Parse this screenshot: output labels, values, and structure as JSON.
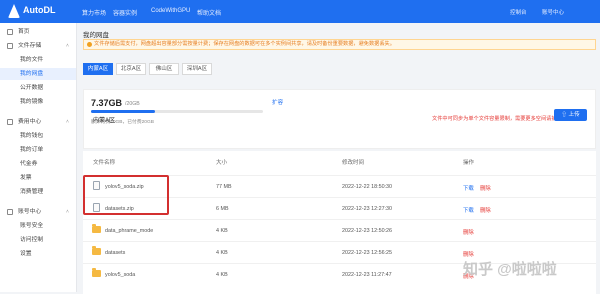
{
  "app": {
    "brand": "AutoDL"
  },
  "topnav": {
    "items": [
      "算力市场",
      "容器实例",
      "CodeWithGPU",
      "帮助文档"
    ],
    "user_menu": [
      "控制台",
      "账号中心"
    ]
  },
  "sidebar": {
    "items": [
      {
        "label": "首页",
        "type": "top"
      },
      {
        "label": "文件存储",
        "type": "group"
      },
      {
        "label": "我的文件",
        "type": "sub"
      },
      {
        "label": "我的网盘",
        "type": "sub",
        "active": true
      },
      {
        "label": "公开数据",
        "type": "sub"
      },
      {
        "label": "我的镜像",
        "type": "sub"
      },
      {
        "label": "费用中心",
        "type": "group"
      },
      {
        "label": "我的钱包",
        "type": "sub"
      },
      {
        "label": "我的订单",
        "type": "sub"
      },
      {
        "label": "代金券",
        "type": "sub"
      },
      {
        "label": "发票",
        "type": "sub"
      },
      {
        "label": "消费管理",
        "type": "sub"
      },
      {
        "label": "账号中心",
        "type": "group"
      },
      {
        "label": "账号安全",
        "type": "sub"
      },
      {
        "label": "访问控制",
        "type": "sub"
      },
      {
        "label": "设置",
        "type": "sub"
      }
    ]
  },
  "page": {
    "title": "我的网盘",
    "notice": "文件存储后需支付，网盘超出容量部分需按量计费；保存在网盘的数据可在多个实例间共享，请及时备份重要数据，避免数据丢失。"
  },
  "tabs": [
    {
      "label": "内蒙A区",
      "active": true
    },
    {
      "label": "北京A区"
    },
    {
      "label": "佛山区"
    },
    {
      "label": "深圳A区"
    }
  ],
  "storage": {
    "used": "7.37GB",
    "total": "/20GB",
    "usage_fraction": 0.37,
    "expand": "扩容",
    "extra": "额外付费20GB，已付费20GB"
  },
  "region": {
    "title": "内蒙A区",
    "note": "文件中可同步为单个文件容量限制，需要更多空间请扩容",
    "upload": "上传"
  },
  "table": {
    "headers": [
      "文件名称",
      "大小",
      "修改时间",
      "操作"
    ],
    "rows": [
      {
        "name": "yolov5_soda.zip",
        "size": "77 MB",
        "time": "2022-12-22 18:50:30",
        "actions": [
          "下载",
          "删除"
        ],
        "kind": "file"
      },
      {
        "name": "datasets.zip",
        "size": "6 MB",
        "time": "2022-12-23 12:27:30",
        "actions": [
          "下载",
          "删除"
        ],
        "kind": "file"
      },
      {
        "name": "data_phrame_mode",
        "size": "4 KB",
        "time": "2022-12-23 12:50:26",
        "actions": [
          "删除"
        ],
        "kind": "folder"
      },
      {
        "name": "datasets",
        "size": "4 KB",
        "time": "2022-12-23 12:56:25",
        "actions": [
          "删除"
        ],
        "kind": "folder"
      },
      {
        "name": "yolov5_soda",
        "size": "4 KB",
        "time": "2022-12-23 11:27:47",
        "actions": [
          "删除"
        ],
        "kind": "folder"
      }
    ]
  },
  "watermark": "知乎 @啦啦啦"
}
